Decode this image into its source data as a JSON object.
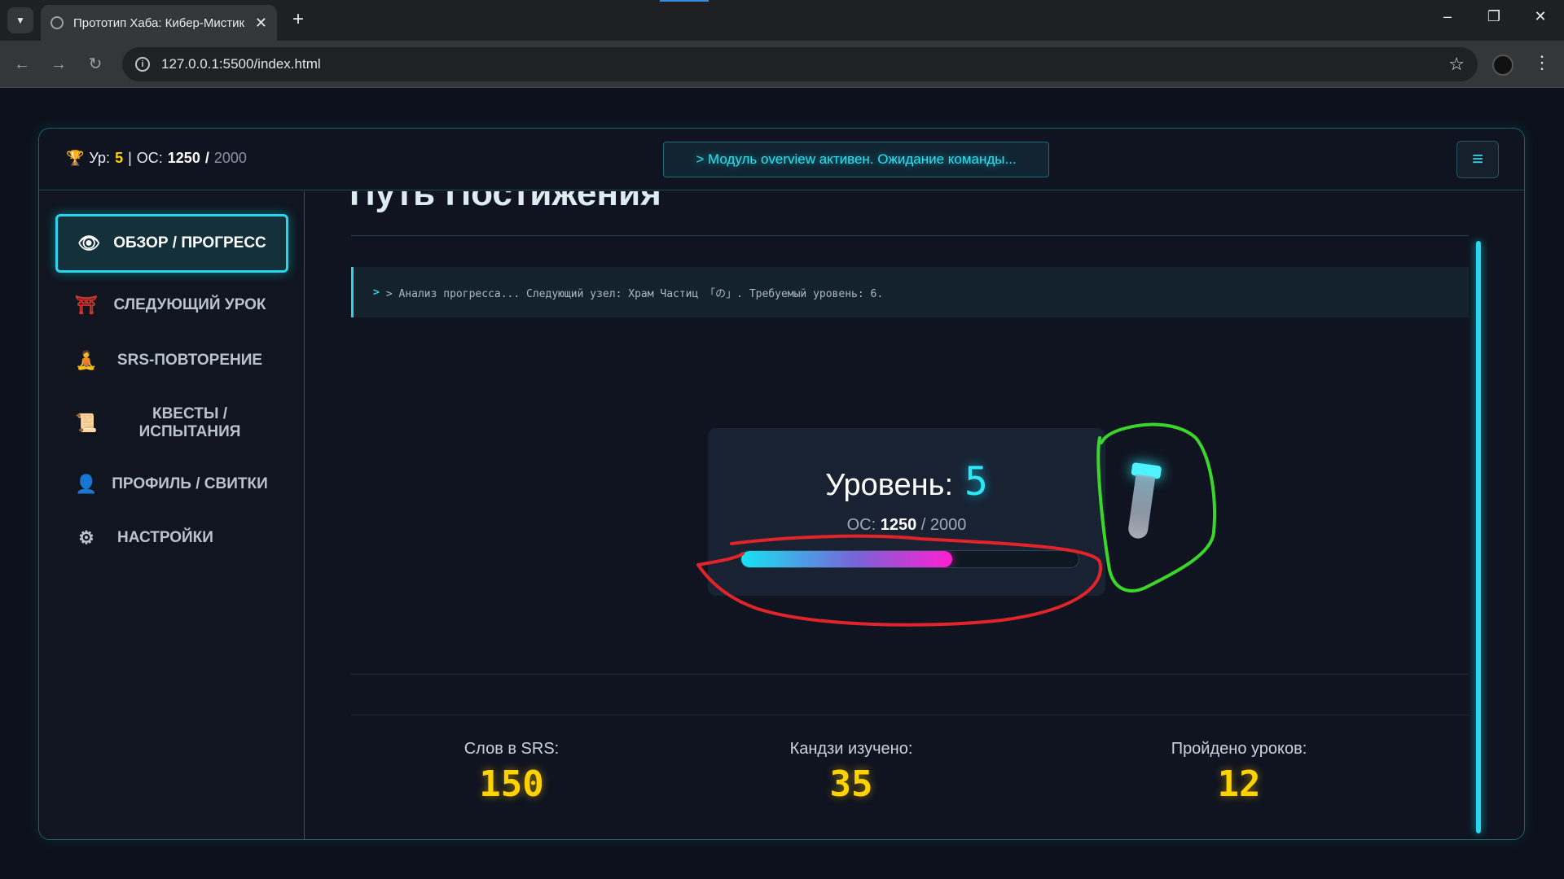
{
  "browser": {
    "tab_title": "Прототип Хаба: Кибер-Мистик",
    "url": "127.0.0.1:5500/index.html"
  },
  "header": {
    "level_label": "Ур:",
    "level_value": "5",
    "xp_label": "ОС:",
    "xp_current": "1250",
    "xp_sep": "/",
    "xp_max": "2000",
    "console_text": "> Модуль overview активен. Ожидание команды..."
  },
  "sidebar": {
    "items": [
      {
        "label": "ОБЗОР / ПРОГРЕСС",
        "icon": "eye-icon",
        "active": true
      },
      {
        "label": "СЛЕДУЮЩИЙ УРОК",
        "icon": "torii-gate-icon"
      },
      {
        "label": "SRS-ПОВТОРЕНИЕ",
        "icon": "meditation-icon"
      },
      {
        "label": "КВЕСТЫ / ИСПЫТАНИЯ",
        "icon": "scroll-icon"
      },
      {
        "label": "ПРОФИЛЬ / СВИТКИ",
        "icon": "ninja-icon"
      },
      {
        "label": "НАСТРОЙКИ",
        "icon": "gear-icon"
      }
    ]
  },
  "main": {
    "title": "Путь Постижения",
    "log_text": "> Анализ прогресса... Следующий узел: Храм Частиц 「の」. Требуемый уровень: 6.",
    "level_card": {
      "level_label": "Уровень:",
      "level_value": "5",
      "os_label": "ОС:",
      "os_current": "1250",
      "os_sep": "/",
      "os_max": "2000",
      "progress_fraction": 0.625
    },
    "stats": [
      {
        "label": "Слов в SRS:",
        "value": "150"
      },
      {
        "label": "Кандзи изучено:",
        "value": "35"
      },
      {
        "label": "Пройдено уроков:",
        "value": "12"
      }
    ]
  },
  "colors": {
    "accent": "#2bd4ea",
    "gold": "#ffd200",
    "magenta": "#ff1fd0",
    "annotation_red": "#e0242a",
    "annotation_green": "#3ad62a"
  }
}
